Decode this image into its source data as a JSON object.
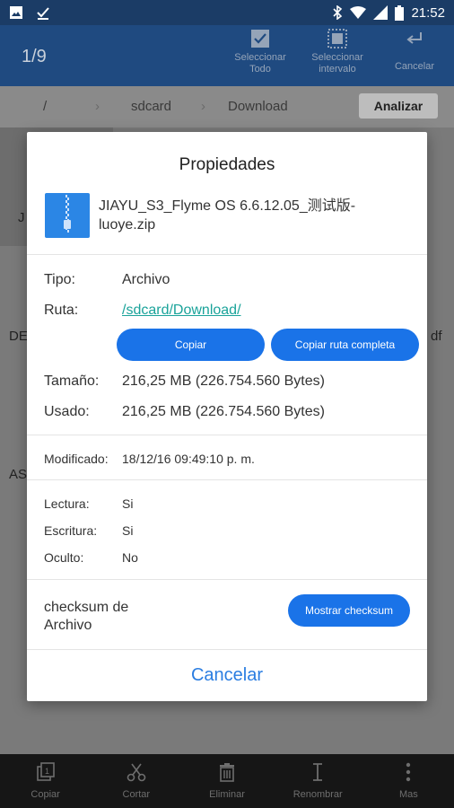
{
  "status_bar": {
    "time": "21:52"
  },
  "toolbar": {
    "counter": "1/9",
    "select_all": "Seleccionar Todo",
    "select_range": "Seleccionar intervalo",
    "cancel": "Cancelar"
  },
  "pathbar": {
    "root": "/",
    "sdcard": "sdcard",
    "download": "Download",
    "analyze": "Analizar"
  },
  "bg_items": {
    "a": "J",
    "b": "DE",
    "c": "df",
    "d": "AS"
  },
  "dialog": {
    "title": "Propiedades",
    "file_name": "JIAYU_S3_Flyme OS 6.6.12.05_测试版-luoye.zip",
    "type_label": "Tipo:",
    "type_value": "Archivo",
    "path_label": "Ruta:",
    "path_value": "/sdcard/Download/",
    "copy_button": "Copiar",
    "copy_path_button": "Copiar ruta completa",
    "size_label": "Tamaño:",
    "size_value": "216,25 MB (226.754.560 Bytes)",
    "used_label": "Usado:",
    "used_value": "216,25 MB (226.754.560 Bytes)",
    "modified_label": "Modificado:",
    "modified_value": "18/12/16 09:49:10 p. m.",
    "read_label": "Lectura:",
    "read_value": "Si",
    "write_label": "Escritura:",
    "write_value": "Si",
    "hidden_label": "Oculto:",
    "hidden_value": "No",
    "checksum_label": "checksum de Archivo",
    "checksum_button": "Mostrar checksum",
    "cancel_button": "Cancelar"
  },
  "bottom_bar": {
    "copy": "Copiar",
    "cut": "Cortar",
    "delete": "Eliminar",
    "rename": "Renombrar",
    "more": "Mas"
  },
  "colors": {
    "accent": "#1a73e8",
    "link": "#1aa39a",
    "toolbar": "#1f4a80"
  }
}
